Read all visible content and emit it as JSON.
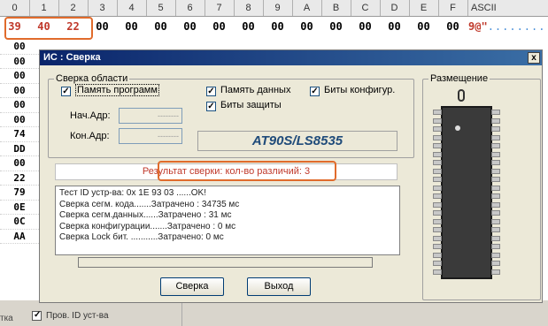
{
  "header": {
    "columns": [
      "0",
      "1",
      "2",
      "3",
      "4",
      "5",
      "6",
      "7",
      "8",
      "9",
      "A",
      "B",
      "C",
      "D",
      "E",
      "F"
    ],
    "ascii_label": "ASCII"
  },
  "row1": {
    "bytes": [
      "39",
      "40",
      "22",
      "00",
      "00",
      "00",
      "00",
      "00",
      "00",
      "00",
      "00",
      "00",
      "00",
      "00",
      "00",
      "00"
    ],
    "ascii": "9@\"",
    "ascii_dots": "........"
  },
  "left_column": [
    "00",
    "00",
    "00",
    "00",
    "00",
    "00",
    "74",
    "DD",
    "00",
    "22",
    "79",
    "0E",
    "0C",
    "AA"
  ],
  "dialog": {
    "title": "ИС : Сверка",
    "close_label": "x",
    "compare_area": {
      "legend": "Сверка области",
      "program_memory": "Память программ",
      "data_memory": "Память данных",
      "config_bits": "Биты конфигур.",
      "protect_bits": "Биты защиты",
      "start_addr_label": "Нач.Адр:",
      "end_addr_label": "Кон.Адр:",
      "start_addr_value": "--------",
      "end_addr_value": "--------"
    },
    "chip_name": "AT90S/LS8535",
    "result": "Результат сверки: кол-во различий:   3",
    "log": [
      "Тест ID устр-ва: 0x 1E 93 03 ......OK!",
      "Сверка сегм. кода.......Затрачено   : 34735 мс",
      "Сверка сегм.данных......Затрачено  : 31 мс",
      "Сверка конфигурации.......Затрачено   : 0 мс",
      "Сверка Lock бит. ...........Затрачено:  0 мс"
    ],
    "buttons": {
      "compare": "Сверка",
      "exit": "Выход"
    },
    "placement_legend": "Размещение"
  },
  "bottom": {
    "label_left": "тка",
    "check_label": "Пров. ID уст-ва"
  }
}
